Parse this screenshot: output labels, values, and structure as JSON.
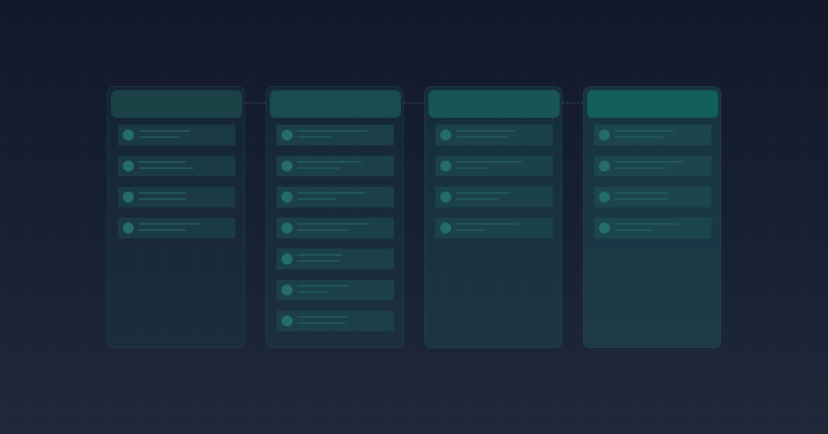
{
  "board": {
    "columns": [
      {
        "cards": [
          {
            "lines": [
              75,
              59
            ]
          },
          {
            "lines": [
              68,
              80
            ]
          },
          {
            "lines": [
              69,
              69
            ]
          },
          {
            "lines": [
              90,
              69
            ]
          }
        ]
      },
      {
        "cards": [
          {
            "lines": [
              101,
              50
            ]
          },
          {
            "lines": [
              93,
              61
            ]
          },
          {
            "lines": [
              98,
              55
            ]
          },
          {
            "lines": [
              105,
              75
            ]
          },
          {
            "lines": [
              65,
              61
            ]
          },
          {
            "lines": [
              74,
              46
            ]
          },
          {
            "lines": [
              73,
              70
            ]
          }
        ]
      },
      {
        "cards": [
          {
            "lines": [
              85,
              74
            ]
          },
          {
            "lines": [
              96,
              44
            ]
          },
          {
            "lines": [
              79,
              62
            ]
          },
          {
            "lines": [
              90,
              44
            ]
          }
        ]
      },
      {
        "cards": [
          {
            "lines": [
              86,
              70
            ]
          },
          {
            "lines": [
              99,
              73
            ]
          },
          {
            "lines": [
              76,
              78
            ]
          },
          {
            "lines": [
              92,
              54
            ]
          }
        ]
      }
    ]
  }
}
